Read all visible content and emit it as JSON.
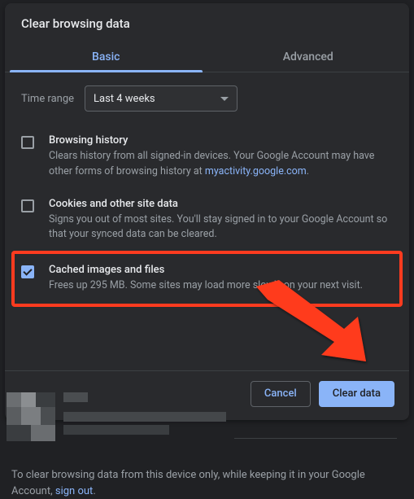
{
  "dialog": {
    "title": "Clear browsing data",
    "tabs": {
      "basic": "Basic",
      "advanced": "Advanced"
    },
    "time_range": {
      "label": "Time range",
      "value": "Last 4 weeks"
    },
    "items": {
      "history": {
        "title": "Browsing history",
        "desc_prefix": "Clears history from all signed-in devices. Your Google Account may have other forms of browsing history at ",
        "desc_link": "myactivity.google.com",
        "desc_suffix": ".",
        "checked": false
      },
      "cookies": {
        "title": "Cookies and other site data",
        "desc": "Signs you out of most sites. You'll stay signed in to your Google Account so that your synced data can be cleared.",
        "checked": false
      },
      "cache": {
        "title": "Cached images and files",
        "desc": "Frees up 295 MB. Some sites may load more slowly on your next visit.",
        "checked": true
      }
    },
    "buttons": {
      "cancel": "Cancel",
      "clear": "Clear data"
    }
  },
  "footer": {
    "text_prefix": "To clear browsing data from this device only, while keeping it in your Google Account, ",
    "link": "sign out",
    "text_suffix": "."
  }
}
